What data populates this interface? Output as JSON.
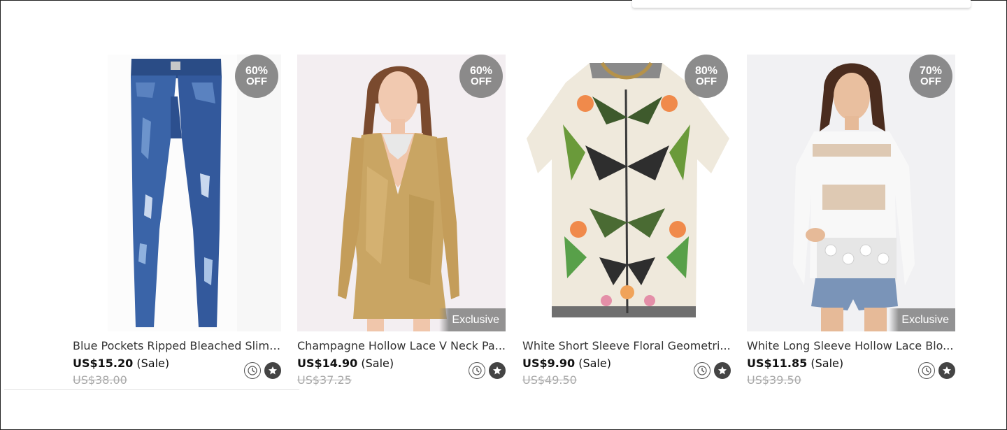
{
  "products": [
    {
      "title": "Blue Pockets Ripped Bleached Slim ...",
      "price": "US$15.20",
      "sale_label": "(Sale)",
      "original_price": "US$38.00",
      "discount_pct": "60%",
      "discount_off": "OFF",
      "exclusive": ""
    },
    {
      "title": "Champagne Hollow Lace V Neck Pa...",
      "price": "US$14.90",
      "sale_label": "(Sale)",
      "original_price": "US$37.25",
      "discount_pct": "60%",
      "discount_off": "OFF",
      "exclusive": "Exclusive"
    },
    {
      "title": "White Short Sleeve Floral Geometri...",
      "price": "US$9.90",
      "sale_label": "(Sale)",
      "original_price": "US$49.50",
      "discount_pct": "80%",
      "discount_off": "OFF",
      "exclusive": ""
    },
    {
      "title": "White Long Sleeve Hollow Lace Blo...",
      "price": "US$11.85",
      "sale_label": "(Sale)",
      "original_price": "US$39.50",
      "discount_pct": "70%",
      "discount_off": "OFF",
      "exclusive": "Exclusive"
    }
  ],
  "icons": {
    "timer": "clock-icon",
    "favorite": "star-icon"
  },
  "colors": {
    "badge": "#787878",
    "price": "#111111",
    "original_price": "#aaaaaa"
  }
}
